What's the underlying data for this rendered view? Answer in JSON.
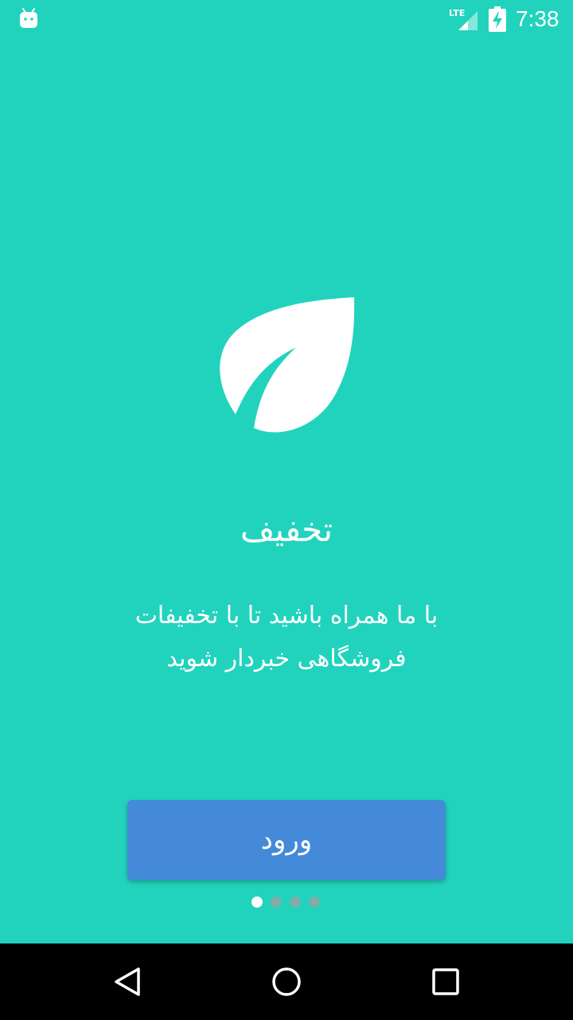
{
  "status_bar": {
    "time": "7:38",
    "network": "LTE",
    "icons": [
      "android-icon",
      "lte-signal-icon",
      "battery-charging-icon"
    ]
  },
  "onboarding": {
    "logo_icon": "leaf-icon",
    "title": "تخفیف",
    "description": "با ما همراه باشید تا با تخفیفات فروشگاهی خبردار شوید",
    "login_label": "ورود",
    "page_count": 4,
    "current_page": 1
  },
  "nav_bar": {
    "icons": [
      "back-icon",
      "home-icon",
      "recents-icon"
    ]
  },
  "colors": {
    "background": "#21d3bd",
    "button": "#448ad8",
    "text": "#ffffff",
    "dot_inactive": "#a0a0a0"
  }
}
